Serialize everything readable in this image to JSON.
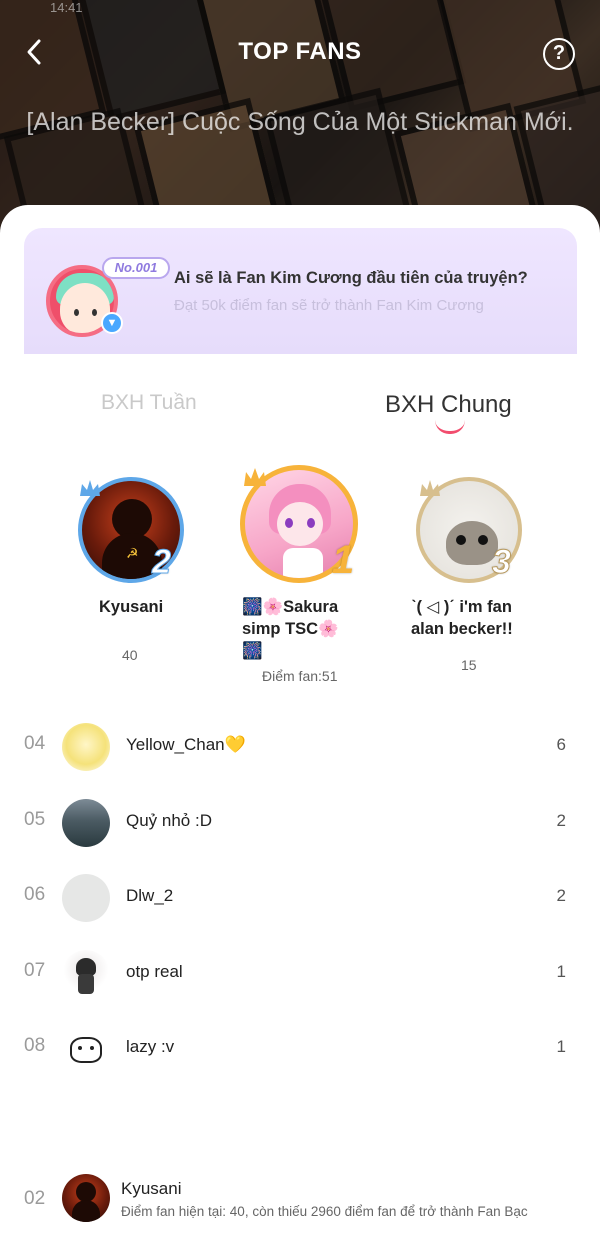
{
  "status_time": "14:41",
  "header": {
    "title": "TOP FANS",
    "story_title": "[Alan Becker] Cuộc Sống Của Một Stickman Mới.",
    "back_icon": "chevron-left-icon",
    "help_icon": "question-circle-icon",
    "help_symbol": "?"
  },
  "banner": {
    "badge": "No.001",
    "heading": "Ai sẽ là Fan Kim Cương đầu tiên của truyện?",
    "subtext": "Đạt 50k điểm fan sẽ trở thành Fan Kim Cương"
  },
  "tabs": [
    {
      "label": "BXH Tuần",
      "active": false
    },
    {
      "label": "BXH Chung",
      "active": true
    }
  ],
  "podium": {
    "first": {
      "rank": "1",
      "name_lines": [
        "🎆🌸Sakura",
        "simp TSC🌸",
        "🎆"
      ],
      "score_label": "Điểm fan:51",
      "ring_color": "#f7b33a"
    },
    "second": {
      "rank": "2",
      "name": "Kyusani",
      "score": "40",
      "ring_color": "#5ea7e8"
    },
    "third": {
      "rank": "3",
      "name_lines": [
        "ˋ( ◁ )ˊ i'm fan",
        "alan becker!!"
      ],
      "score": "15",
      "ring_color": "#d7bf8e"
    }
  },
  "list": [
    {
      "rank": "04",
      "name": "Yellow_Chan💛",
      "points": "6"
    },
    {
      "rank": "05",
      "name": "Quỷ nhỏ :D",
      "points": "2"
    },
    {
      "rank": "06",
      "name": "Dlw_2",
      "points": "2"
    },
    {
      "rank": "07",
      "name": "otp real",
      "points": "1"
    },
    {
      "rank": "08",
      "name": "lazy :v",
      "points": "1"
    }
  ],
  "me": {
    "rank": "02",
    "name": "Kyusani",
    "description": "Điểm fan hiện tại: 40, còn thiếu 2960 điểm fan để trở thành Fan Bạc"
  }
}
